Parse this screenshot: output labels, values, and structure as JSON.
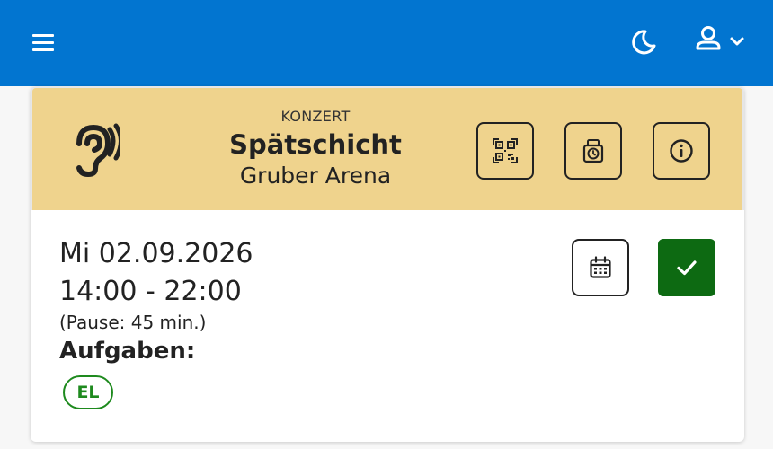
{
  "header": {
    "icons": {
      "menu": "hamburger-icon",
      "theme": "moon-icon",
      "user": "user-icon",
      "dropdown": "chevron-down-icon"
    },
    "colors": {
      "background": "#0275d0",
      "icon": "#ffffff"
    }
  },
  "shift": {
    "category": "KONZERT",
    "title": "Spätschicht",
    "venue": "Gruber Arena",
    "icon": "ear-icon",
    "header_color": "#efd38d",
    "actions": [
      {
        "name": "qr-code",
        "icon": "qr-code-icon"
      },
      {
        "name": "time-tracker",
        "icon": "timer-device-icon"
      },
      {
        "name": "info",
        "icon": "info-icon"
      }
    ]
  },
  "details": {
    "date": "Mi 02.09.2026",
    "time": "14:00 - 22:00",
    "pause": "(Pause: 45 min.)",
    "tasks_label": "Aufgaben:",
    "tasks": [
      "EL"
    ],
    "task_color": "#1e8a1e",
    "calendar_icon": "calendar-icon",
    "confirm_icon": "check-icon",
    "confirm_color": "#0d6a12"
  }
}
